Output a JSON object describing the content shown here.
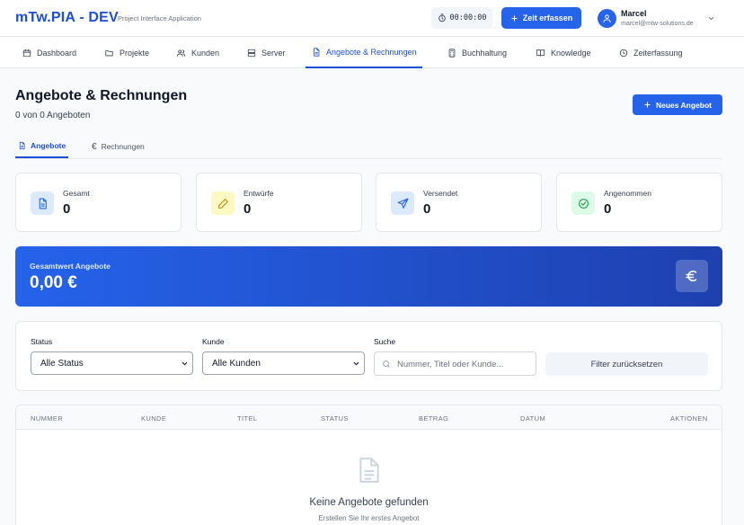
{
  "header": {
    "brand": "mTw.PIA - DEV",
    "subtitle": "Project Interface Application",
    "timer": "00:00:00",
    "time_button": "Zeit erfassen",
    "user_name": "Marcel",
    "user_email": "marcel@mtw-solutions.de"
  },
  "nav": [
    {
      "label": "Dashboard",
      "icon": "calendar-icon"
    },
    {
      "label": "Projekte",
      "icon": "folder-icon"
    },
    {
      "label": "Kunden",
      "icon": "users-icon"
    },
    {
      "label": "Server",
      "icon": "server-icon"
    },
    {
      "label": "Angebote & Rechnungen",
      "icon": "document-icon",
      "active": true
    },
    {
      "label": "Buchhaltung",
      "icon": "calculator-icon"
    },
    {
      "label": "Knowledge",
      "icon": "book-icon"
    },
    {
      "label": "Zeiterfassung",
      "icon": "clock-icon"
    }
  ],
  "page": {
    "title": "Angebote & Rechnungen",
    "subtitle": "0 von 0 Angeboten",
    "new_button": "Neues Angebot"
  },
  "tabs": [
    {
      "label": "Angebote",
      "icon": "document-icon",
      "active": true
    },
    {
      "label": "Rechnungen",
      "icon": "euro-icon",
      "active": false
    }
  ],
  "stats": [
    {
      "label": "Gesamt",
      "value": "0",
      "icon": "document-icon",
      "color": "#2563eb",
      "bg": "#dbeafe"
    },
    {
      "label": "Entwürfe",
      "value": "0",
      "icon": "pencil-icon",
      "color": "#ca8a04",
      "bg": "#fef9c3"
    },
    {
      "label": "Versendet",
      "value": "0",
      "icon": "send-icon",
      "color": "#2563eb",
      "bg": "#dbeafe"
    },
    {
      "label": "Angenommen",
      "value": "0",
      "icon": "check-circle-icon",
      "color": "#16a34a",
      "bg": "#dcfce7"
    }
  ],
  "total": {
    "label": "Gesamtwert Angebote",
    "value": "0,00 €",
    "icon": "euro-icon"
  },
  "filters": {
    "status_label": "Status",
    "status_value": "Alle Status",
    "customer_label": "Kunde",
    "customer_value": "Alle Kunden",
    "search_label": "Suche",
    "search_placeholder": "Nummer, Titel oder Kunde...",
    "reset_button": "Filter zurücksetzen"
  },
  "table": {
    "columns": [
      "NUMMER",
      "KUNDE",
      "TITEL",
      "STATUS",
      "BETRAG",
      "DATUM",
      "AKTIONEN"
    ],
    "empty_title": "Keine Angebote gefunden",
    "empty_subtitle": "Erstellen Sie Ihr erstes Angebot"
  },
  "colors": {
    "accent": "#2563eb",
    "accent_dark": "#1e40af"
  }
}
